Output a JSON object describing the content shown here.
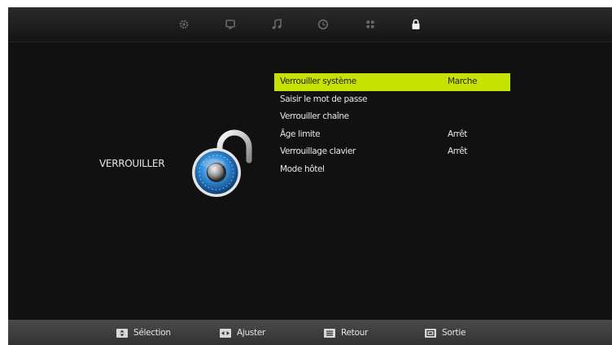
{
  "tabs": [
    {
      "icon": "picture-gear-icon",
      "active": false
    },
    {
      "icon": "tv-screen-icon",
      "active": false
    },
    {
      "icon": "music-note-icon",
      "active": false
    },
    {
      "icon": "clock-icon",
      "active": false
    },
    {
      "icon": "options-grid-icon",
      "active": false
    },
    {
      "icon": "lock-icon",
      "active": true
    }
  ],
  "page": {
    "title": "VERROUILLER",
    "icon": "padlock-icon"
  },
  "menu": {
    "items": [
      {
        "label": "Verrouiller système",
        "value": "Marche",
        "selected": true
      },
      {
        "label": "Saisir le mot de passe",
        "value": ""
      },
      {
        "label": "Verrouiller chaîne",
        "value": ""
      },
      {
        "label": "Âge limite",
        "value": "Arrêt"
      },
      {
        "label": "Verrouillage clavier",
        "value": "Arrêt"
      },
      {
        "label": "Mode hôtel",
        "value": ""
      }
    ]
  },
  "footer": {
    "hints": [
      {
        "label": "Sélection",
        "icon": "arrows-updown-key-icon"
      },
      {
        "label": "Ajuster",
        "icon": "arrows-leftright-key-icon"
      },
      {
        "label": "Retour",
        "icon": "menu-key-icon"
      },
      {
        "label": "Sortie",
        "icon": "exit-key-icon"
      }
    ]
  },
  "colors": {
    "highlight": "#c6e200",
    "background": "#111111",
    "text": "#e8e8e8"
  }
}
